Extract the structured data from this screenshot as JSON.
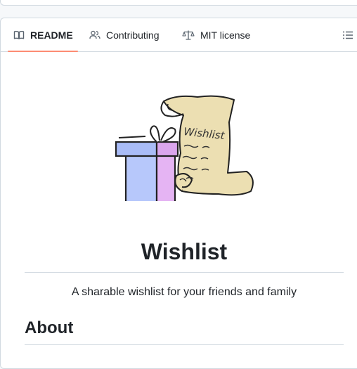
{
  "tabs": [
    {
      "label": "README",
      "icon": "book-icon",
      "active": true
    },
    {
      "label": "Contributing",
      "icon": "people-icon",
      "active": false
    },
    {
      "label": "MIT license",
      "icon": "law-scale-icon",
      "active": false
    }
  ],
  "outline_button": {
    "icon": "list-unordered-icon"
  },
  "readme": {
    "logo_text": "Wishlist",
    "title": "Wishlist",
    "tagline": "A sharable wishlist for your friends and family",
    "section_heading": "About"
  },
  "colors": {
    "active_tab_underline": "#fd8c73",
    "border": "#d1d9e0",
    "text": "#1f2328",
    "icon": "#59636e",
    "box_blue": "#b7c8fb",
    "box_pink": "#e5b4f3",
    "scroll_paper": "#ecdfb2"
  }
}
